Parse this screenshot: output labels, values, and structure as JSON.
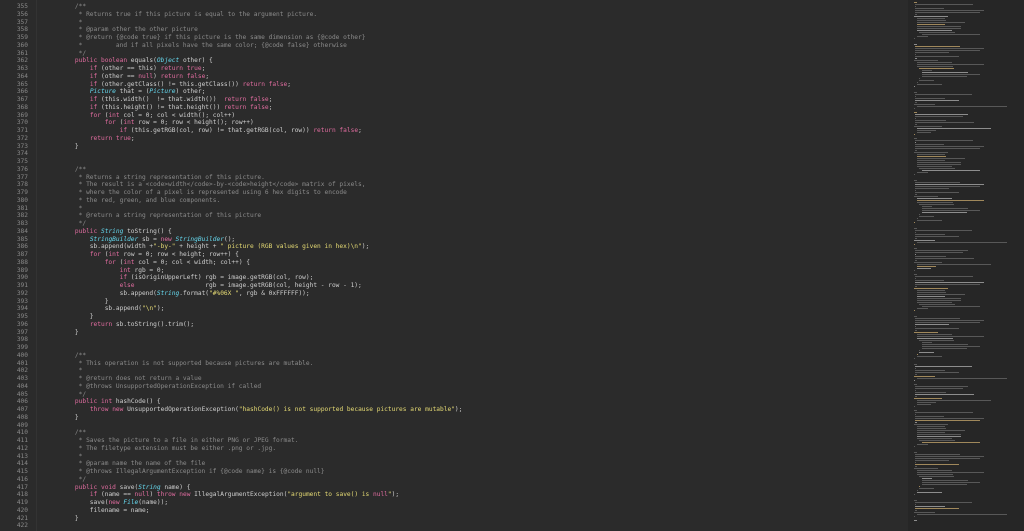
{
  "editor": {
    "first_line": 355,
    "lines": [
      "    /**",
      "     * Returns true if this picture is equal to the argument picture.",
      "     *",
      "     * @param other the other picture",
      "     * @return {@code true} if this picture is the same dimension as {@code other}",
      "     *         and if all pixels have the same color; {@code false} otherwise",
      "     */",
      "    public boolean equals(Object other) {",
      "        if (other == this) return true;",
      "        if (other == null) return false;",
      "        if (other.getClass() != this.getClass()) return false;",
      "        Picture that = (Picture) other;",
      "        if (this.width()  != that.width())  return false;",
      "        if (this.height() != that.height()) return false;",
      "        for (int col = 0; col < width(); col++)",
      "            for (int row = 0; row < height(); row++)",
      "                if (this.getRGB(col, row) != that.getRGB(col, row)) return false;",
      "        return true;",
      "    }",
      "",
      "",
      "    /**",
      "     * Returns a string representation of this picture.",
      "     * The result is a <code>width</code>-by-<code>height</code> matrix of pixels,",
      "     * where the color of a pixel is represented using 6 hex digits to encode",
      "     * the red, green, and blue components.",
      "     *",
      "     * @return a string representation of this picture",
      "     */",
      "    public String toString() {",
      "        StringBuilder sb = new StringBuilder();",
      "        sb.append(width +\"-by-\" + height + \" picture (RGB values given in hex)\\n\");",
      "        for (int row = 0; row < height; row++) {",
      "            for (int col = 0; col < width; col++) {",
      "                int rgb = 0;",
      "                if (isOriginUpperLeft) rgb = image.getRGB(col, row);",
      "                else                   rgb = image.getRGB(col, height - row - 1);",
      "                sb.append(String.format(\"#%06X \", rgb & 0xFFFFFF));",
      "            }",
      "            sb.append(\"\\n\");",
      "        }",
      "        return sb.toString().trim();",
      "    }",
      "",
      "",
      "    /**",
      "     * This operation is not supported because pictures are mutable.",
      "     *",
      "     * @return does not return a value",
      "     * @throws UnsupportedOperationException if called",
      "     */",
      "    public int hashCode() {",
      "        throw new UnsupportedOperationException(\"hashCode() is not supported because pictures are mutable\");",
      "    }",
      "",
      "    /**",
      "     * Saves the picture to a file in either PNG or JPEG format.",
      "     * The filetype extension must be either .png or .jpg.",
      "     *",
      "     * @param name the name of the file",
      "     * @throws IllegalArgumentException if {@code name} is {@code null}",
      "     */",
      "    public void save(String name) {",
      "        if (name == null) throw new IllegalArgumentException(\"argument to save() is null\");",
      "        save(new File(name));",
      "        filename = name;",
      "    }",
      ""
    ]
  }
}
